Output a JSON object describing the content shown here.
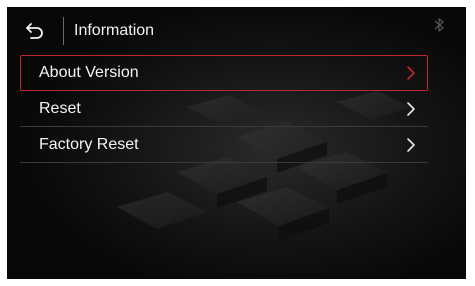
{
  "header": {
    "back_icon": "back-arrow-icon",
    "title": "Information",
    "status_icon": "bluetooth-icon"
  },
  "menu": {
    "items": [
      {
        "label": "About Version",
        "selected": true,
        "icon": "chevron-right-icon"
      },
      {
        "label": "Reset",
        "selected": false,
        "icon": "chevron-right-icon"
      },
      {
        "label": "Factory Reset",
        "selected": false,
        "icon": "chevron-right-icon"
      }
    ]
  },
  "colors": {
    "background": "#0b0b0b",
    "selection_border": "#c0262d",
    "text": "#f4f4f4",
    "separator": "#3a3a3a"
  }
}
